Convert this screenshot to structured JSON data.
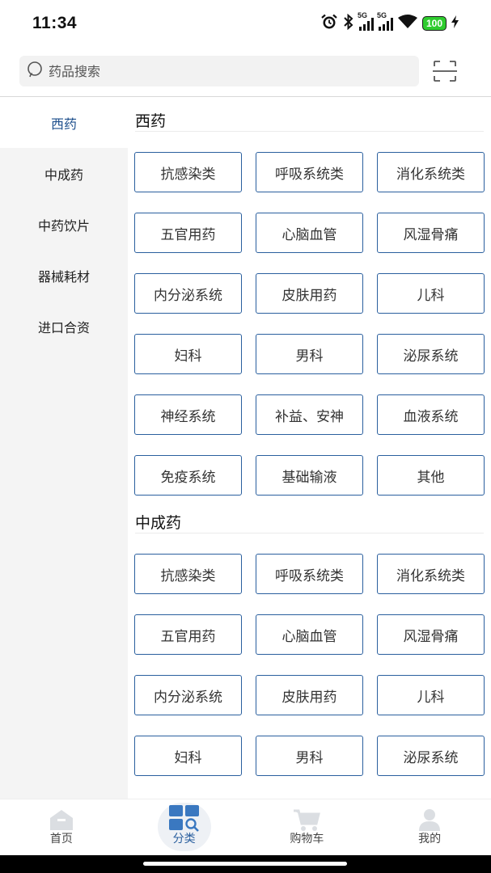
{
  "status_bar": {
    "time": "11:34",
    "network_1": "5G",
    "network_2": "5G",
    "battery": "100",
    "icons": [
      "alarm-icon",
      "bluetooth-icon",
      "signal-icon",
      "signal-icon",
      "wifi-icon",
      "battery-icon",
      "charging-icon"
    ]
  },
  "search": {
    "placeholder": "药品搜索",
    "icon": "search-icon",
    "scan_icon": "scan-icon"
  },
  "sidebar": {
    "items": [
      {
        "label": "西药",
        "active": true
      },
      {
        "label": "中成药",
        "active": false
      },
      {
        "label": "中药饮片",
        "active": false
      },
      {
        "label": "器械耗材",
        "active": false
      },
      {
        "label": "进口合资",
        "active": false
      }
    ]
  },
  "sections": [
    {
      "title": "西药",
      "categories": [
        "抗感染类",
        "呼吸系统类",
        "消化系统类",
        "五官用药",
        "心脑血管",
        "风湿骨痛",
        "内分泌系统",
        "皮肤用药",
        "儿科",
        "妇科",
        "男科",
        "泌尿系统",
        "神经系统",
        "补益、安神",
        "血液系统",
        "免疫系统",
        "基础输液",
        "其他"
      ]
    },
    {
      "title": "中成药",
      "categories": [
        "抗感染类",
        "呼吸系统类",
        "消化系统类",
        "五官用药",
        "心脑血管",
        "风湿骨痛",
        "内分泌系统",
        "皮肤用药",
        "儿科",
        "妇科",
        "男科",
        "泌尿系统"
      ]
    }
  ],
  "bottom_nav": {
    "items": [
      {
        "label": "首页",
        "icon": "home-icon",
        "active": false
      },
      {
        "label": "分类",
        "icon": "category-icon",
        "active": true
      },
      {
        "label": "购物车",
        "icon": "cart-icon",
        "active": false
      },
      {
        "label": "我的",
        "icon": "profile-icon",
        "active": false
      }
    ]
  },
  "colors": {
    "accent": "#2a5f9e",
    "sidebar_active_text": "#1d4f8c",
    "sidebar_bg": "#f4f4f4",
    "battery_green": "#2ecc2e"
  }
}
